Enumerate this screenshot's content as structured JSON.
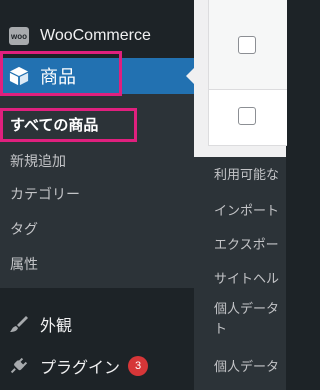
{
  "sidebar": {
    "woocommerce": {
      "logo_text": "woo",
      "label": "WooCommerce"
    },
    "products": {
      "label": "商品"
    },
    "submenu": [
      {
        "label": "すべての商品",
        "current": true
      },
      {
        "label": "新規追加"
      },
      {
        "label": "カテゴリー"
      },
      {
        "label": "タグ"
      },
      {
        "label": "属性"
      }
    ],
    "appearance": {
      "label": "外観",
      "icon": "paintbrush-icon"
    },
    "plugins": {
      "label": "プラグイン",
      "icon": "plugin-icon",
      "badge": "3"
    }
  },
  "tools_flyout": {
    "items": [
      {
        "label": "利用可能な"
      },
      {
        "label": "インポート"
      },
      {
        "label": "エクスポー"
      },
      {
        "label": "サイトヘル"
      },
      {
        "label": "個人データ ト"
      },
      {
        "label": "個人データ"
      }
    ]
  },
  "colors": {
    "sidebar_bg": "#1d2327",
    "submenu_bg": "#2c3338",
    "active_bg": "#2271b1",
    "highlight": "#e0207e",
    "badge_bg": "#d63638"
  }
}
